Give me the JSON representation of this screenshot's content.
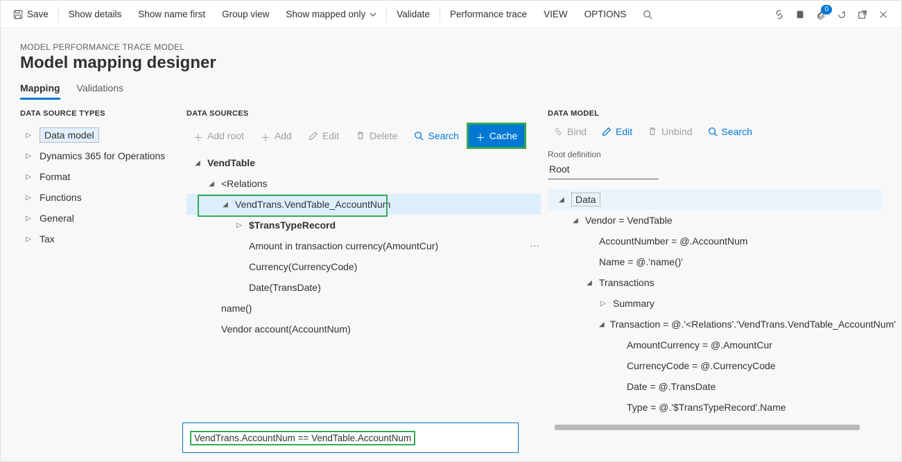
{
  "toolbar": {
    "save": "Save",
    "showDetails": "Show details",
    "showNameFirst": "Show name first",
    "groupView": "Group view",
    "showMappedOnly": "Show mapped only",
    "validate": "Validate",
    "performanceTrace": "Performance trace",
    "view": "VIEW",
    "options": "OPTIONS",
    "badgeCount": "0"
  },
  "breadcrumb": "MODEL PERFORMANCE TRACE MODEL",
  "pageTitle": "Model mapping designer",
  "tabs": {
    "mapping": "Mapping",
    "validations": "Validations"
  },
  "types": {
    "header": "DATA SOURCE TYPES",
    "items": [
      "Data model",
      "Dynamics 365 for Operations",
      "Format",
      "Functions",
      "General",
      "Tax"
    ]
  },
  "sources": {
    "header": "DATA SOURCES",
    "actions": {
      "addRoot": "Add root",
      "add": "Add",
      "edit": "Edit",
      "delete": "Delete",
      "search": "Search",
      "cache": "Cache"
    },
    "tree": {
      "root": "VendTable",
      "relations": "<Relations",
      "relnode": "VendTrans.VendTable_AccountNum",
      "transType": "$TransTypeRecord",
      "amount": "Amount in transaction currency(AmountCur)",
      "currency": "Currency(CurrencyCode)",
      "date": "Date(TransDate)",
      "name": "name()",
      "vendAcc": "Vendor account(AccountNum)"
    },
    "formula": "VendTrans.AccountNum == VendTable.AccountNum"
  },
  "model": {
    "header": "DATA MODEL",
    "actions": {
      "bind": "Bind",
      "edit": "Edit",
      "unbind": "Unbind",
      "search": "Search"
    },
    "rootLabel": "Root definition",
    "rootValue": "Root",
    "tree": {
      "data": "Data",
      "vendor": "Vendor = VendTable",
      "accNum": "AccountNumber = @.AccountNum",
      "name": "Name = @.'name()'",
      "transactions": "Transactions",
      "summary": "Summary",
      "transaction": "Transaction = @.'<Relations'.'VendTrans.VendTable_AccountNum'",
      "amountCur": "AmountCurrency = @.AmountCur",
      "curCode": "CurrencyCode = @.CurrencyCode",
      "dateEq": "Date = @.TransDate",
      "typeEq": "Type = @.'$TransTypeRecord'.Name"
    }
  }
}
